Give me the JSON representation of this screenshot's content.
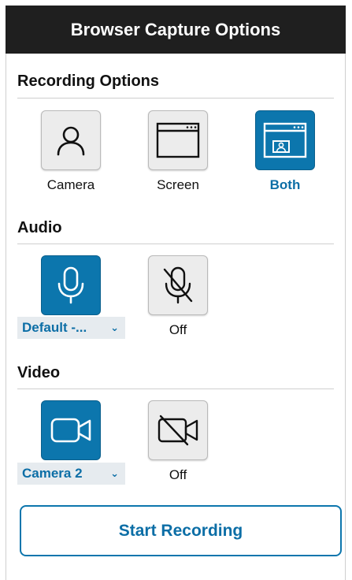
{
  "window": {
    "title": "Browser Capture Options"
  },
  "recording": {
    "heading": "Recording Options",
    "options": [
      {
        "label": "Camera",
        "icon": "person-icon",
        "selected": false
      },
      {
        "label": "Screen",
        "icon": "browser-window-icon",
        "selected": false
      },
      {
        "label": "Both",
        "icon": "browser-window-with-person-icon",
        "selected": true
      }
    ]
  },
  "audio": {
    "heading": "Audio",
    "device_select": "Default -...",
    "on_icon": "microphone-icon",
    "off_icon": "microphone-muted-icon",
    "off_label": "Off",
    "selected": "device"
  },
  "video": {
    "heading": "Video",
    "device_select": "Camera 2",
    "on_icon": "video-camera-icon",
    "off_icon": "video-camera-off-icon",
    "off_label": "Off",
    "selected": "device"
  },
  "actions": {
    "start_label": "Start Recording"
  },
  "colors": {
    "accent": "#0c76ad",
    "title_bg": "#1f1f1f",
    "select_bg": "#e6ebef"
  }
}
